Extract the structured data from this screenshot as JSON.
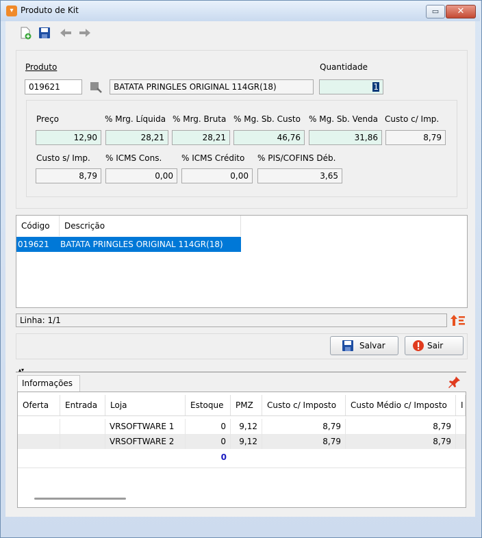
{
  "window": {
    "title": "Produto de Kit",
    "minimize_label": "▭",
    "close_label": "✕"
  },
  "toolbar": {
    "new_icon": "new-document-icon",
    "save_icon": "save-icon",
    "prev_icon": "arrow-left-icon",
    "next_icon": "arrow-right-icon"
  },
  "produto": {
    "label": "Produto",
    "code": "019621",
    "description": "BATATA PRINGLES ORIGINAL 114GR(18)"
  },
  "quantidade": {
    "label": "Quantidade",
    "value": "1"
  },
  "price_fields": [
    {
      "label": "Preço",
      "value": "12,90"
    },
    {
      "label": "% Mrg. Líquida",
      "value": "28,21"
    },
    {
      "label": "% Mrg. Bruta",
      "value": "28,21"
    },
    {
      "label": "% Mg. Sb. Custo",
      "value": "46,76"
    },
    {
      "label": "% Mg. Sb. Venda",
      "value": "31,86"
    },
    {
      "label": "Custo c/ Imp.",
      "value": "8,79"
    }
  ],
  "tax_fields": [
    {
      "label": "Custo s/ Imp.",
      "value": "8,79"
    },
    {
      "label": "% ICMS Cons.",
      "value": "0,00"
    },
    {
      "label": "% ICMS Crédito",
      "value": "0,00"
    },
    {
      "label": "% PIS/COFINS Déb.",
      "value": "3,65"
    }
  ],
  "items_table": {
    "columns": [
      "Código",
      "Descrição"
    ],
    "rows": [
      {
        "codigo": "019621",
        "descricao": "BATATA PRINGLES ORIGINAL 114GR(18)"
      }
    ]
  },
  "status": {
    "linha": "Linha: 1/1"
  },
  "buttons": {
    "salvar": "Salvar",
    "sair": "Sair"
  },
  "info_tab": {
    "label": "Informações"
  },
  "info_table": {
    "columns": [
      "Oferta",
      "Entrada",
      "Loja",
      "Estoque",
      "PMZ",
      "Custo c/ Imposto",
      "Custo Médio c/ Imposto",
      "I"
    ],
    "rows": [
      {
        "oferta": "",
        "entrada": "",
        "loja": "VRSOFTWARE 1",
        "estoque": "0",
        "pmz": "9,12",
        "custo": "8,79",
        "custo_medio": "8,79"
      },
      {
        "oferta": "",
        "entrada": "",
        "loja": "VRSOFTWARE 2",
        "estoque": "0",
        "pmz": "9,12",
        "custo": "8,79",
        "custo_medio": "8,79"
      }
    ],
    "total_estoque": "0"
  }
}
